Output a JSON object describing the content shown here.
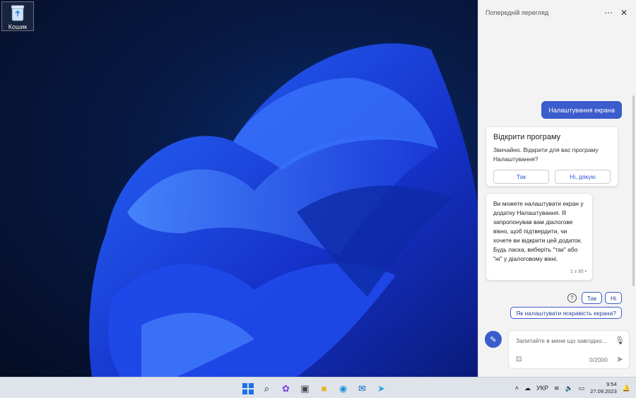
{
  "desktop": {
    "recycle_bin_label": "Кошик"
  },
  "copilot": {
    "title": "Попередній перегляд",
    "user_message": "Налаштування екрана",
    "card_open_app": {
      "title": "Відкрити програму",
      "text": "Звичайно. Відкрити для вас програму Налаштування?",
      "yes_label": "Так",
      "no_label": "Ні, дякую"
    },
    "response": {
      "text": "Ви можете налаштувати екран у додатку Налаштування. Я запропонував вам діалогове вікно, щоб підтвердити, чи хочете ви відкрити цей додаток. Будь ласка, виберіть \"так\" або \"ні\" у діалоговому вікні.",
      "counter": "1 з 30"
    },
    "suggestions": {
      "yes": "Так",
      "no": "Ні",
      "brightness": "Як налаштувати яскравість екрана?"
    },
    "input": {
      "placeholder": "Запитайте в мене що завгодно...",
      "char_count": "0/2000"
    }
  },
  "taskbar": {
    "language": "УКР",
    "time": "9:54",
    "date": "27.09.2023"
  },
  "colors": {
    "accent": "#3a5ccc",
    "panel_bg": "#f3f3f3",
    "taskbar_bg": "#dfe3ea"
  }
}
